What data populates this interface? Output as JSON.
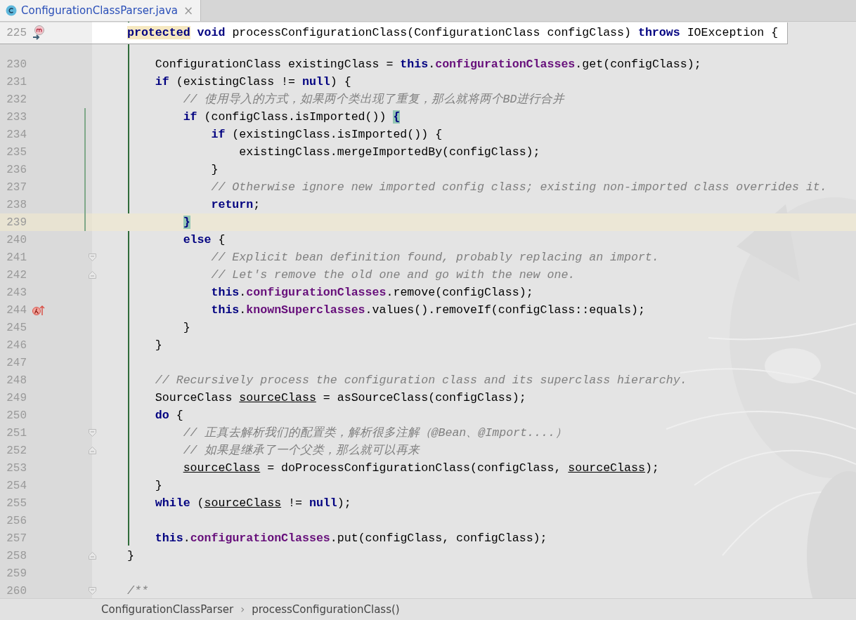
{
  "tab": {
    "title": "ConfigurationClassParser.java",
    "close": "×",
    "selected": true
  },
  "sticky_line": {
    "number": "225",
    "gutter_mark": {
      "kind": "method"
    },
    "tokens": [
      {
        "kind": "keyword",
        "text": "protected",
        "highlighted": true
      },
      {
        "kind": "keyword",
        "text": " void"
      },
      {
        "kind": "plain",
        "text": " processConfigurationClass(ConfigurationClass configClass) "
      },
      {
        "kind": "keyword",
        "text": "throws"
      },
      {
        "kind": "plain",
        "text": " IOException {"
      }
    ]
  },
  "method_body": [
    {
      "number": "230",
      "tokens": [
        {
          "kind": "plain",
          "text": "ConfigurationClass existingClass = "
        },
        {
          "kind": "keyword",
          "text": "this"
        },
        {
          "kind": "plain",
          "text": "."
        },
        {
          "kind": "field",
          "text": "configurationClasses"
        },
        {
          "kind": "plain",
          "text": ".get(configClass);"
        }
      ]
    },
    {
      "number": "231",
      "tokens": [
        {
          "kind": "keyword",
          "text": "if"
        },
        {
          "kind": "plain",
          "text": " (existingClass != "
        },
        {
          "kind": "keyword",
          "text": "null"
        },
        {
          "kind": "plain",
          "text": ") {"
        }
      ],
      "children": [
        {
          "number": "232",
          "tokens": [
            {
              "kind": "comment",
              "text": "// 使用导入的方式，如果两个类出现了重复，那么就将两个BD进行合并"
            }
          ]
        },
        {
          "number": "233",
          "changed": true,
          "tokens": [
            {
              "kind": "keyword",
              "text": "if"
            },
            {
              "kind": "plain",
              "text": " (configClass.isImported()) "
            },
            {
              "kind": "match",
              "text": "{"
            }
          ],
          "children": [
            {
              "number": "234",
              "changed": true,
              "tokens": [
                {
                  "kind": "keyword",
                  "text": "if"
                },
                {
                  "kind": "plain",
                  "text": " (existingClass.isImported()) {"
                }
              ],
              "children": [
                {
                  "number": "235",
                  "changed": true,
                  "tokens": [
                    {
                      "kind": "plain",
                      "text": "existingClass.mergeImportedBy(configClass);"
                    }
                  ]
                }
              ]
            },
            {
              "number": "236",
              "changed": true,
              "tokens": [
                {
                  "kind": "plain",
                  "text": "}"
                }
              ]
            },
            {
              "number": "237",
              "changed": true,
              "tokens": [
                {
                  "kind": "comment",
                  "text": "// Otherwise ignore new imported config class; existing non-imported class overrides it."
                }
              ]
            },
            {
              "number": "238",
              "changed": true,
              "tokens": [
                {
                  "kind": "keyword",
                  "text": "return"
                },
                {
                  "kind": "plain",
                  "text": ";"
                }
              ]
            }
          ]
        },
        {
          "number": "239",
          "changed": true,
          "current": true,
          "tokens": [
            {
              "kind": "match",
              "text": "}"
            }
          ]
        },
        {
          "number": "240",
          "tokens": [
            {
              "kind": "keyword",
              "text": "else"
            },
            {
              "kind": "plain",
              "text": " {"
            }
          ],
          "children": [
            {
              "number": "241",
              "fold": {
                "kind": "start"
              },
              "tokens": [
                {
                  "kind": "comment",
                  "text": "// Explicit bean definition found, probably replacing an import."
                }
              ]
            },
            {
              "number": "242",
              "fold": {
                "kind": "end"
              },
              "tokens": [
                {
                  "kind": "comment",
                  "text": "// Let's remove the old one and go with the new one."
                }
              ]
            },
            {
              "number": "243",
              "tokens": [
                {
                  "kind": "keyword",
                  "text": "this"
                },
                {
                  "kind": "plain",
                  "text": "."
                },
                {
                  "kind": "field",
                  "text": "configurationClasses"
                },
                {
                  "kind": "plain",
                  "text": ".remove(configClass);"
                }
              ]
            },
            {
              "number": "244",
              "gutter_mark": {
                "kind": "lambda"
              },
              "tokens": [
                {
                  "kind": "keyword",
                  "text": "this"
                },
                {
                  "kind": "plain",
                  "text": "."
                },
                {
                  "kind": "field",
                  "text": "knownSuperclasses"
                },
                {
                  "kind": "plain",
                  "text": ".values().removeIf(configClass::equals);"
                }
              ]
            }
          ]
        },
        {
          "number": "245",
          "tokens": [
            {
              "kind": "plain",
              "text": "}"
            }
          ]
        }
      ]
    },
    {
      "number": "246",
      "tokens": [
        {
          "kind": "plain",
          "text": "}"
        }
      ]
    },
    {
      "number": "247"
    },
    {
      "number": "248",
      "tokens": [
        {
          "kind": "comment",
          "text": "// Recursively process the configuration class and its superclass hierarchy."
        }
      ]
    },
    {
      "number": "249",
      "tokens": [
        {
          "kind": "plain",
          "text": "SourceClass "
        },
        {
          "kind": "var",
          "text": "sourceClass"
        },
        {
          "kind": "plain",
          "text": " = asSourceClass(configClass);"
        }
      ]
    },
    {
      "number": "250",
      "tokens": [
        {
          "kind": "keyword",
          "text": "do"
        },
        {
          "kind": "plain",
          "text": " {"
        }
      ],
      "children": [
        {
          "number": "251",
          "fold": {
            "kind": "start"
          },
          "tokens": [
            {
              "kind": "comment",
              "text": "// 正真去解析我们的配置类，解析很多注解（@Bean、@Import....）"
            }
          ]
        },
        {
          "number": "252",
          "fold": {
            "kind": "end"
          },
          "tokens": [
            {
              "kind": "comment",
              "text": "// 如果是继承了一个父类，那么就可以再来"
            }
          ]
        },
        {
          "number": "253",
          "tokens": [
            {
              "kind": "var",
              "text": "sourceClass"
            },
            {
              "kind": "plain",
              "text": " = doProcessConfigurationClass(configClass, "
            },
            {
              "kind": "var",
              "text": "sourceClass"
            },
            {
              "kind": "plain",
              "text": ");"
            }
          ]
        }
      ]
    },
    {
      "number": "254",
      "tokens": [
        {
          "kind": "plain",
          "text": "}"
        }
      ]
    },
    {
      "number": "255",
      "tokens": [
        {
          "kind": "keyword",
          "text": "while"
        },
        {
          "kind": "plain",
          "text": " ("
        },
        {
          "kind": "var",
          "text": "sourceClass"
        },
        {
          "kind": "plain",
          "text": " != "
        },
        {
          "kind": "keyword",
          "text": "null"
        },
        {
          "kind": "plain",
          "text": ");"
        }
      ]
    },
    {
      "number": "256"
    },
    {
      "number": "257",
      "tokens": [
        {
          "kind": "keyword",
          "text": "this"
        },
        {
          "kind": "plain",
          "text": "."
        },
        {
          "kind": "field",
          "text": "configurationClasses"
        },
        {
          "kind": "plain",
          "text": ".put(configClass, configClass);"
        }
      ]
    }
  ],
  "after_method": [
    {
      "number": "258",
      "fold": {
        "kind": "end"
      },
      "tokens": [
        {
          "kind": "plain",
          "text": "}"
        }
      ]
    },
    {
      "number": "259"
    },
    {
      "number": "260",
      "fold": {
        "kind": "start"
      },
      "tokens": [
        {
          "kind": "comment",
          "text": "/**"
        }
      ]
    }
  ],
  "breadcrumbs": [
    "ConfigurationClassParser",
    "processConfigurationClass()"
  ],
  "breadcrumb_separator": "›"
}
